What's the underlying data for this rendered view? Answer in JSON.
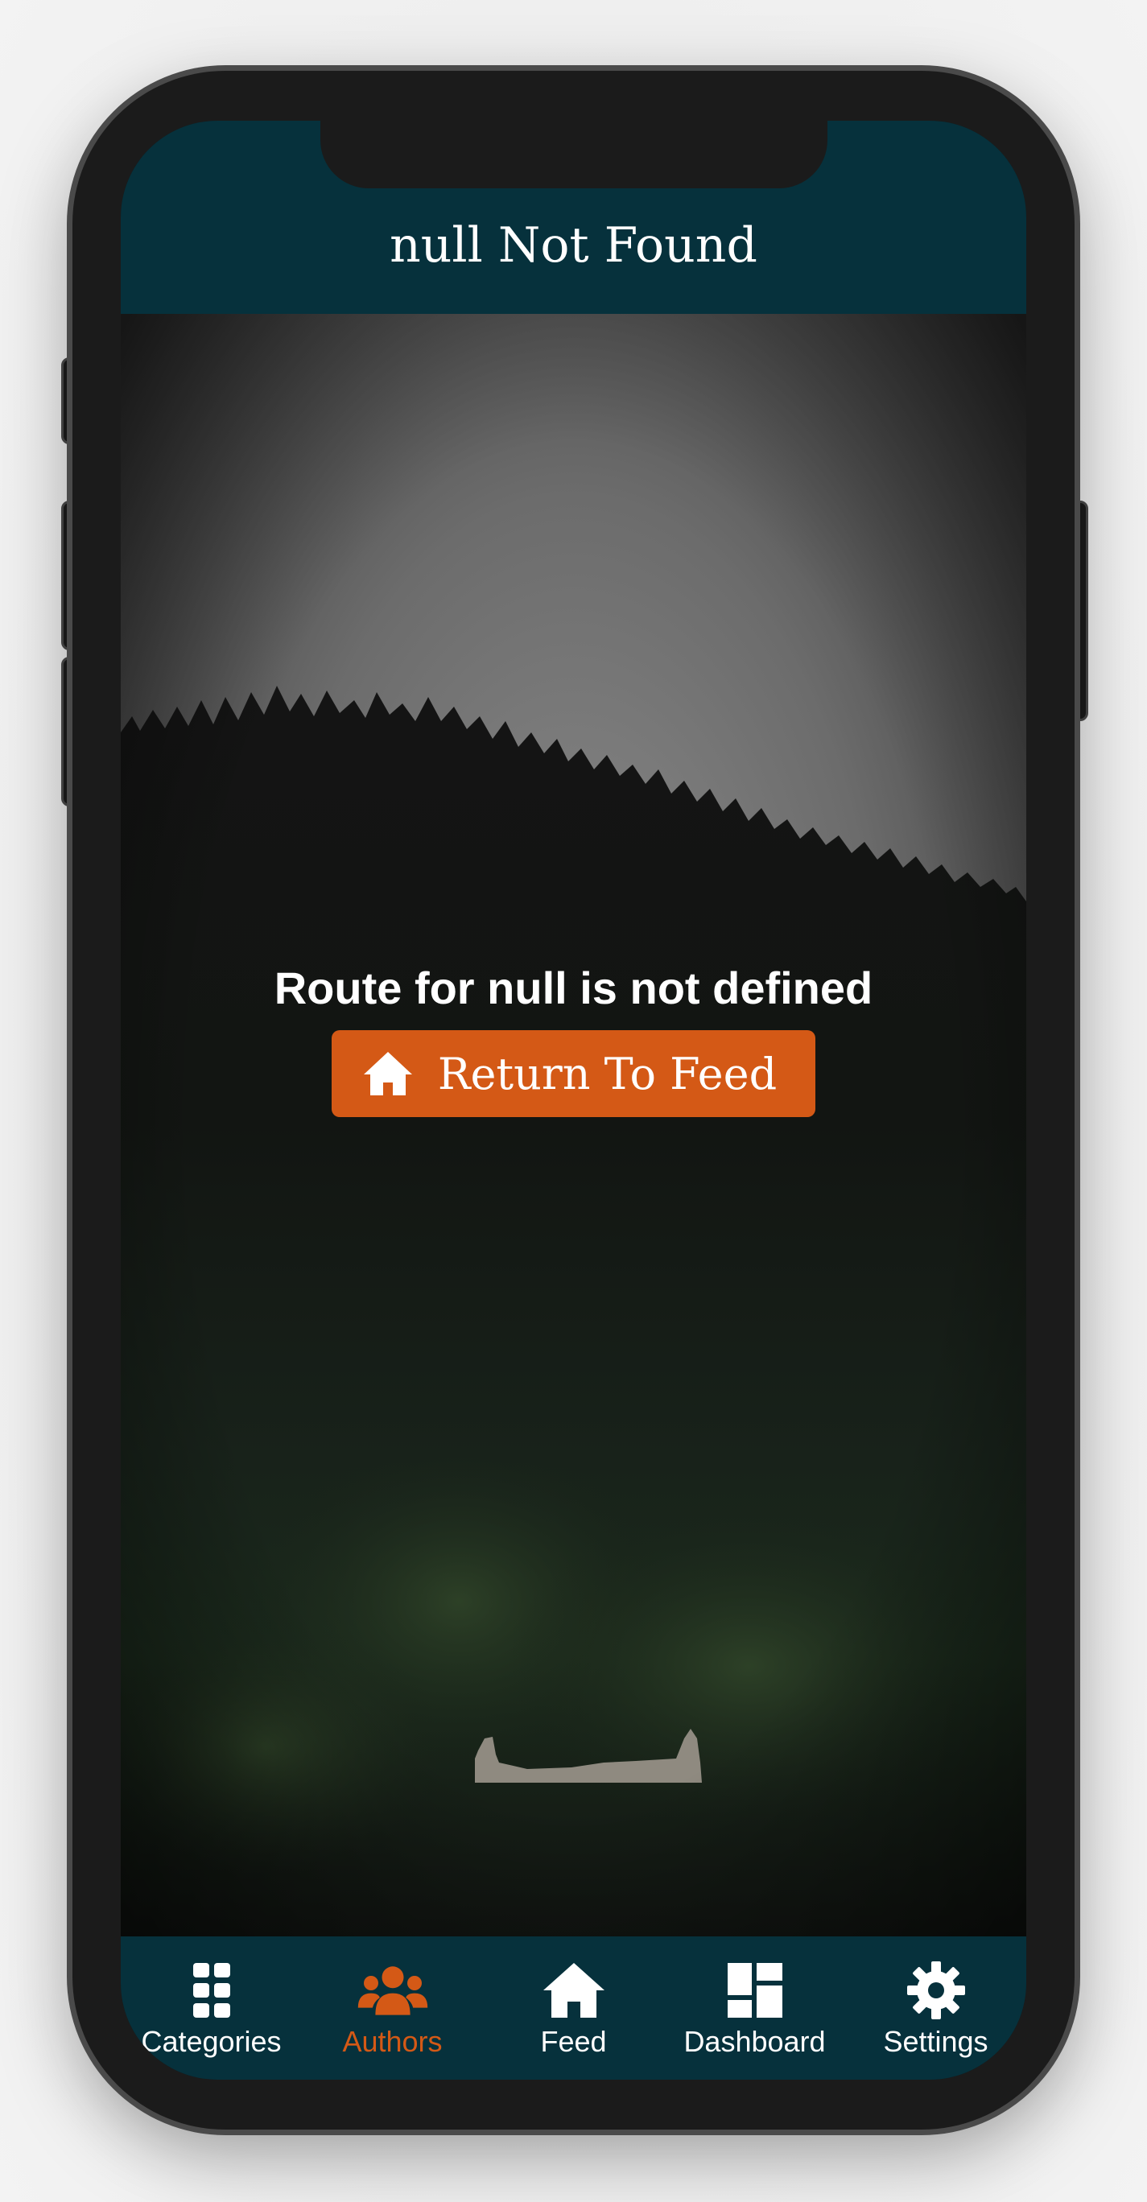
{
  "header": {
    "title": "null Not Found"
  },
  "main": {
    "error_message": "Route for null is not defined",
    "return_button_label": "Return To Feed",
    "return_button_icon": "home-icon"
  },
  "tabbar": {
    "items": [
      {
        "label": "Categories",
        "icon": "grid-icon",
        "active": false
      },
      {
        "label": "Authors",
        "icon": "users-icon",
        "active": true
      },
      {
        "label": "Feed",
        "icon": "home-icon",
        "active": false
      },
      {
        "label": "Dashboard",
        "icon": "dashboard-icon",
        "active": false
      },
      {
        "label": "Settings",
        "icon": "gear-icon",
        "active": false
      }
    ]
  },
  "colors": {
    "header_bg": "#06313c",
    "accent": "#d45916",
    "text": "#ffffff"
  }
}
